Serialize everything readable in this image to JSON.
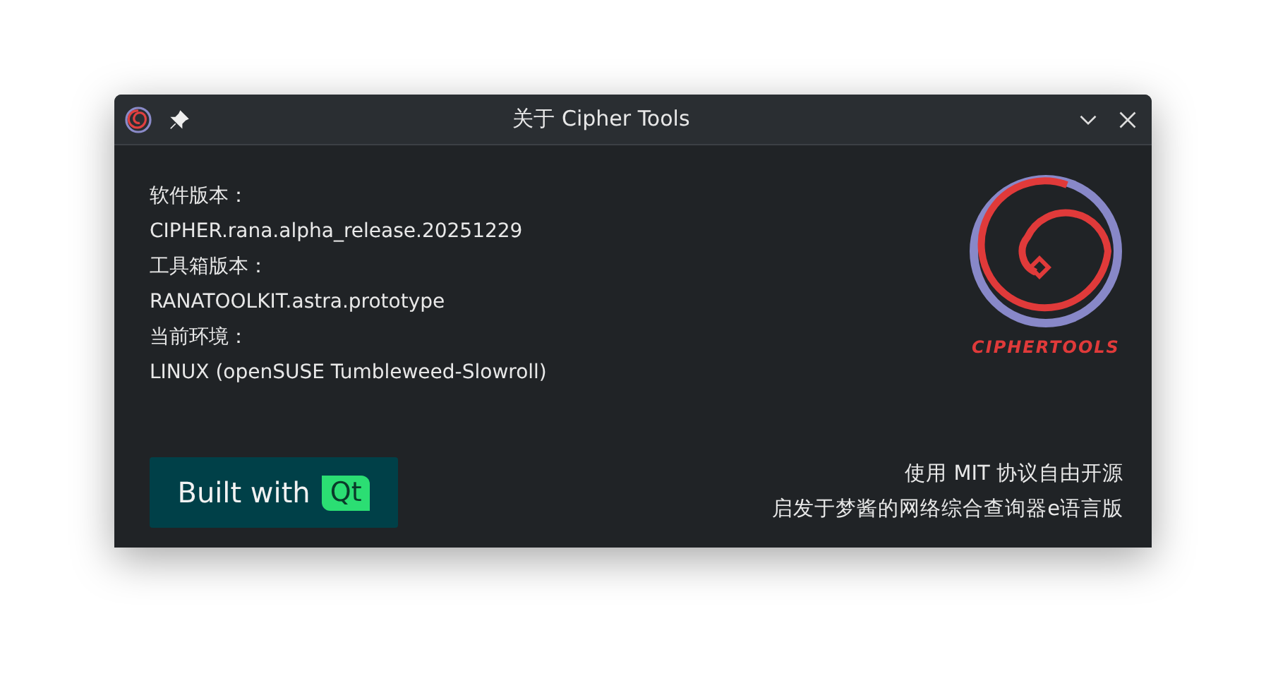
{
  "window": {
    "title": "关于 Cipher Tools"
  },
  "info": [
    {
      "label": "软件版本：",
      "value": "CIPHER.rana.alpha_release.20251229"
    },
    {
      "label": "工具箱版本：",
      "value": "RANATOOLKIT.astra.prototype"
    },
    {
      "label": "当前环境：",
      "value": "LINUX (openSUSE Tumbleweed-Slowroll)"
    }
  ],
  "logo": {
    "wordmark": "CIPHERTOOLS"
  },
  "badge": {
    "text": "Built with",
    "mark": "Qt"
  },
  "notes": [
    "使用 MIT 协议自由开源",
    "启发于梦酱的网络综合查询器e语言版"
  ]
}
